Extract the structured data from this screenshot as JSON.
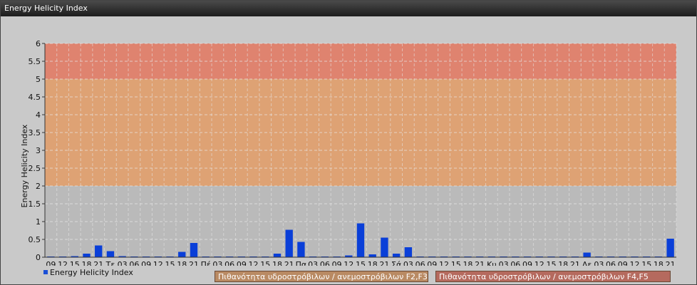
{
  "window": {
    "title": "Energy Helicity Index"
  },
  "legend": {
    "series_label": "Energy Helicity Index",
    "band_f2f3": "Πιθανότητα υδροστρόβιλων / ανεμοστρόβιλων F2,F3",
    "band_f4f5": "Πιθανότητα υδροστρόβιλων / ανεμοστρόβιλων F4,F5"
  },
  "colors": {
    "bar": "#0a3fd8",
    "band_low": "#b9b9b9",
    "band_mid": "#dfa070",
    "band_high": "#e0806a",
    "grid": "#e8e8e8"
  },
  "chart_data": {
    "type": "bar",
    "title": "",
    "xlabel": "",
    "ylabel": "Energy Helicity Index",
    "ylim": [
      0,
      6
    ],
    "yticks": [
      0,
      0.5,
      1,
      1.5,
      2,
      2.5,
      3,
      3.5,
      4,
      4.5,
      5,
      5.5,
      6
    ],
    "grid": true,
    "bands": [
      {
        "from": 0,
        "to": 2
      },
      {
        "from": 2,
        "to": 5
      },
      {
        "from": 5,
        "to": 6
      }
    ],
    "categories": [
      "09",
      "12",
      "15",
      "18",
      "21",
      "Τε",
      "03",
      "06",
      "09",
      "12",
      "15",
      "18",
      "21",
      "Πέ",
      "03",
      "06",
      "09",
      "12",
      "15",
      "18",
      "21",
      "Πα",
      "03",
      "06",
      "09",
      "12",
      "15",
      "18",
      "21",
      "Σά",
      "03",
      "06",
      "09",
      "12",
      "15",
      "18",
      "21",
      "Κυ",
      "03",
      "06",
      "09",
      "12",
      "15",
      "18",
      "21",
      "Δε",
      "03",
      "06",
      "09",
      "12",
      "15",
      "18",
      "21"
    ],
    "values": [
      0.02,
      0.02,
      0.03,
      0.1,
      0.33,
      0.17,
      0.03,
      0.02,
      0.02,
      0.02,
      0.02,
      0.15,
      0.4,
      0.02,
      0.02,
      0.02,
      0.02,
      0.02,
      0.02,
      0.1,
      0.77,
      0.43,
      0.02,
      0.02,
      0.02,
      0.05,
      0.95,
      0.08,
      0.55,
      0.1,
      0.28,
      0.02,
      0.02,
      0.02,
      0.02,
      0.02,
      0.02,
      0.02,
      0.02,
      0.02,
      0.02,
      0.02,
      0.02,
      0.02,
      0.02,
      0.13,
      0.02,
      0.02,
      0.02,
      0.02,
      0.02,
      0.02,
      0.52
    ]
  }
}
